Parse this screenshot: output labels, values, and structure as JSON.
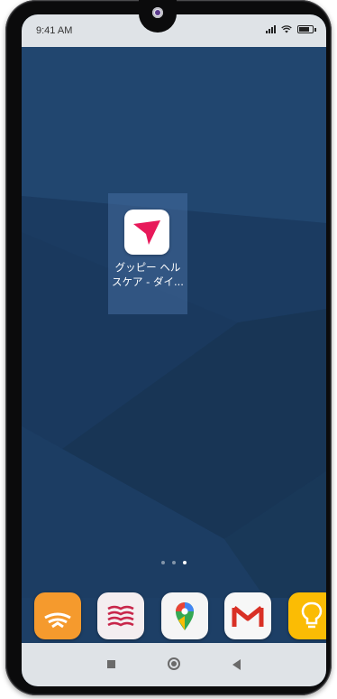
{
  "status_bar": {
    "time": "9:41 AM",
    "icons": [
      "signal-icon",
      "wifi-icon",
      "battery-icon"
    ]
  },
  "home": {
    "app": {
      "icon": "guppy-health-icon",
      "label_line1": "グッピー ヘル",
      "label_line2": "スケア - ダイ..."
    },
    "page_indicator": {
      "pages": 3,
      "current": 3
    }
  },
  "dock": {
    "apps": [
      {
        "icon": "audible-icon"
      },
      {
        "icon": "kindle-pages-icon"
      },
      {
        "icon": "google-maps-icon"
      },
      {
        "icon": "gmail-icon"
      },
      {
        "icon": "keep-notes-icon"
      }
    ]
  },
  "nav_bar": {
    "buttons": [
      "recents-square-icon",
      "home-circle-icon",
      "back-triangle-icon"
    ]
  },
  "colors": {
    "wallpaper": "#1d3f66",
    "status_bar": "#dfe3e7",
    "accent_pink": "#e8195a"
  }
}
